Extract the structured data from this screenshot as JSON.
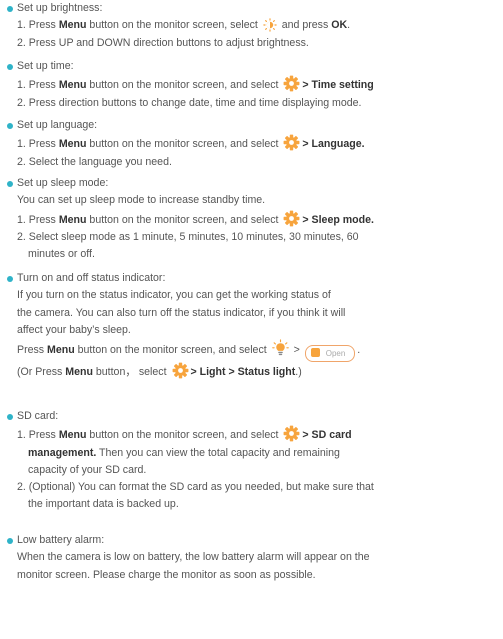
{
  "brightness": {
    "title": "Set up brightness:",
    "l1_a": "1. Press ",
    "l1_menu": "Menu",
    "l1_b": " button on the monitor screen, select ",
    "l1_c": " and press ",
    "l1_ok": "OK",
    "l1_d": ".",
    "l2": "2. Press UP and DOWN direction buttons to adjust brightness."
  },
  "time": {
    "title": "Set up time:",
    "l1_a": "1. Press ",
    "l1_menu": "Menu",
    "l1_b": " button on the monitor screen, and select ",
    "l1_setting": "> Time setting",
    "l2": "2. Press direction buttons to change date, time and time displaying mode."
  },
  "language": {
    "title": "Set up language:",
    "l1_a": "1. Press ",
    "l1_menu": "Menu",
    "l1_b": " button on the monitor screen, and select ",
    "l1_setting": "> Language.",
    "l2": "2. Select the language you need."
  },
  "sleep": {
    "title": "Set up sleep mode:",
    "intro": "You can set up sleep mode to increase standby time.",
    "l1_a": "1. Press ",
    "l1_menu": "Menu",
    "l1_b": " button on the monitor screen, and select ",
    "l1_setting": "> Sleep mode.",
    "l2": "2. Select sleep mode as 1 minute, 5 minutes, 10 minutes, 30 minutes, 60",
    "l2b": "minutes or off."
  },
  "status": {
    "title": "Turn on and off status indicator:",
    "p1": "If you turn on the status indicator, you can get the working status of",
    "p2": "the camera. You can also turn off the status indicator, if you think it will",
    "p3": "affect your baby’s sleep.",
    "l1_a": "Press ",
    "l1_menu": "Menu",
    "l1_b": " button on the monitor screen, and select ",
    "l1_gt": " > ",
    "l1_end": ".",
    "pill_label": "Open",
    "l2_a": "(Or Press ",
    "l2_menu": "Menu",
    "l2_b": " button， select ",
    "l2_setting": "> Light > Status light",
    "l2_c": ".)"
  },
  "sdcard": {
    "title": "SD card:",
    "l1_a": "1. Press ",
    "l1_menu": "Menu",
    "l1_b": " button on the monitor screen, and select ",
    "l1_setting": "> SD card",
    "l1b_bold": "management.",
    "l1b_rest": " Then you can view the total capacity and remaining",
    "l1c": "capacity of your SD card.",
    "l2": "2. (Optional) You can format the SD card as you needed, but make sure that",
    "l2b": "the important data is backed up."
  },
  "battery": {
    "title": "Low battery alarm:",
    "p1": "When the camera is low on battery, the low battery alarm will appear on the",
    "p2": "monitor screen. Please charge the monitor as soon as possible."
  },
  "colors": {
    "bullet": "#2fb3c8",
    "gear": "#f7a43d",
    "text": "#555555"
  }
}
